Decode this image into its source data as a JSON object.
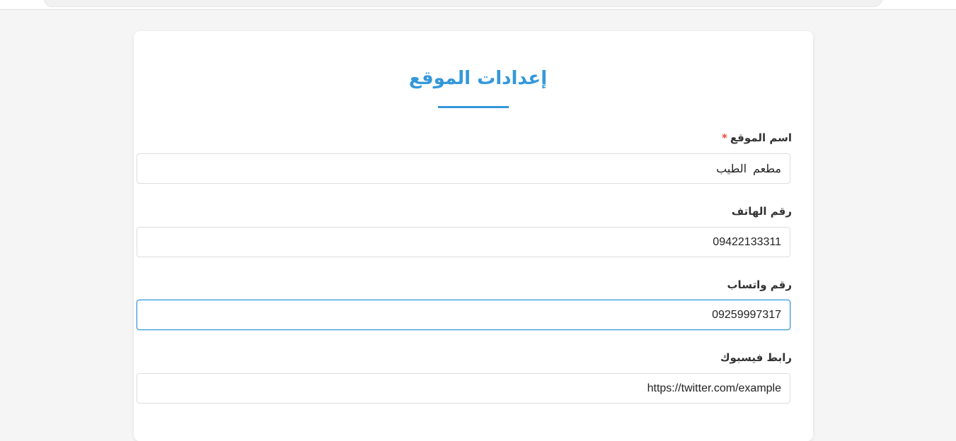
{
  "page": {
    "title": "إعدادات الموقع"
  },
  "fields": [
    {
      "label": "اسم الموقع",
      "required_marker": "*",
      "value": "مطعم  الطيب"
    },
    {
      "label": "رقم الهاتف",
      "value": "09422133311"
    },
    {
      "label": "رقم واتساب",
      "value": "09259997317"
    },
    {
      "label": "رابط فيسبوك",
      "value": "https://twitter.com/example"
    }
  ],
  "colors": {
    "accent": "#3498db",
    "required": "#e74c3c",
    "background": "#f5f5f5"
  }
}
